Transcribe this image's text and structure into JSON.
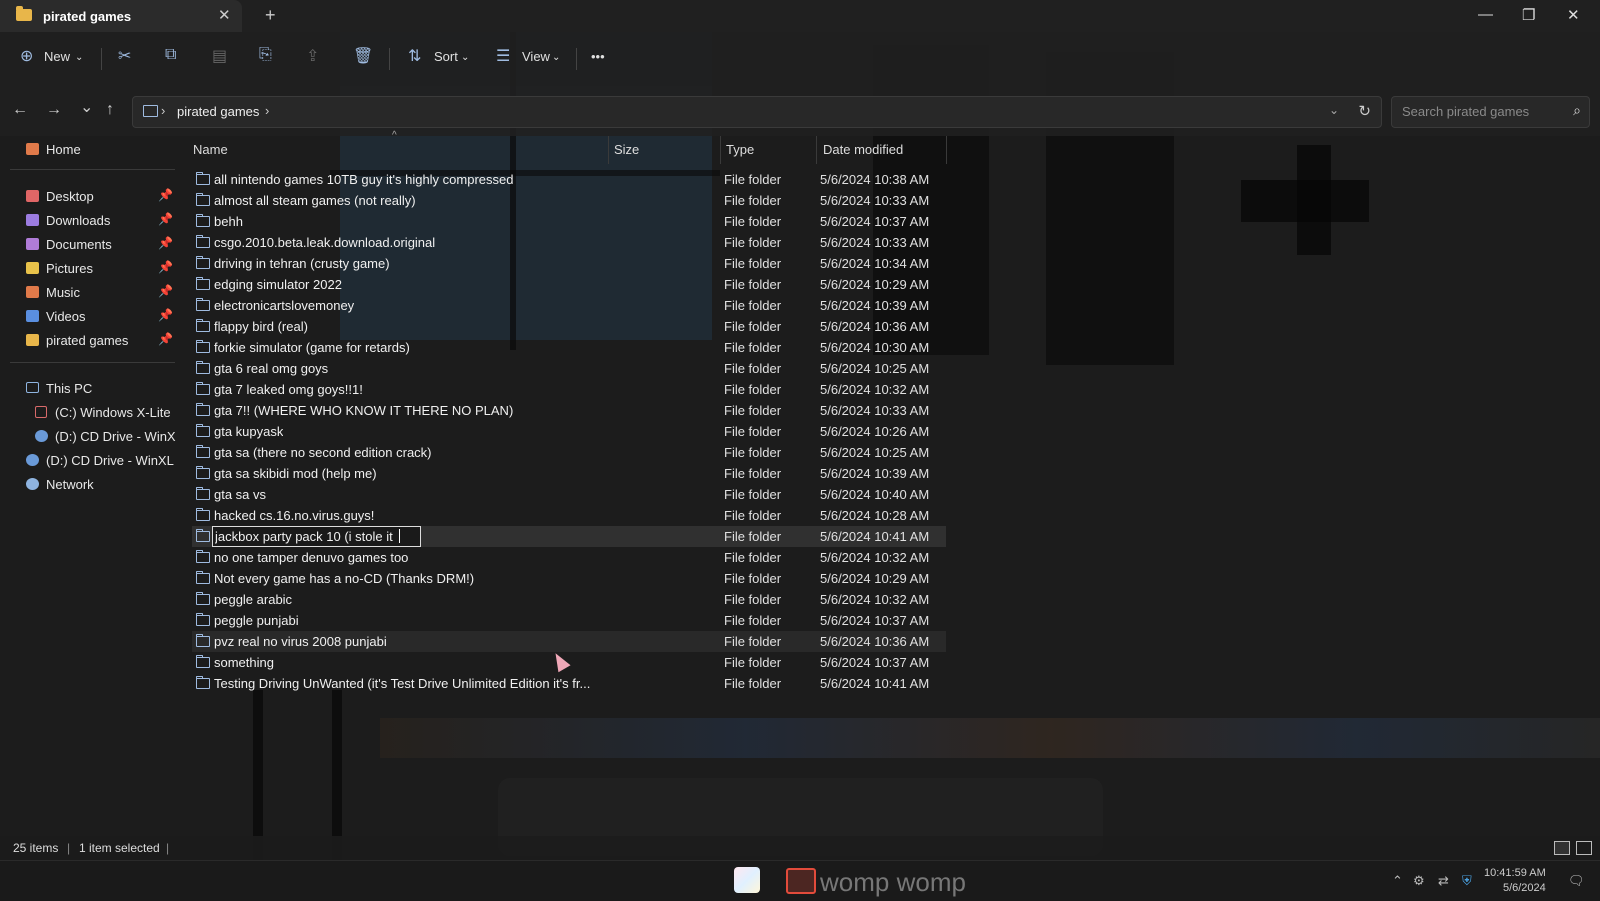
{
  "window": {
    "tab_title": "pirated games",
    "close_tab": "✕",
    "new_tab": "+",
    "minimize": "—",
    "maximize": "❐",
    "close": "✕"
  },
  "toolbar": {
    "new_label": "New",
    "sort_label": "Sort",
    "view_label": "View",
    "more": "•••"
  },
  "navigation": {
    "back": "←",
    "forward": "→",
    "recent": "⌄",
    "up": "↑",
    "breadcrumb": "pirated games",
    "search_placeholder": "Search pirated games"
  },
  "sidebar": {
    "home": "Home",
    "quick_access": [
      {
        "label": "Desktop",
        "color": "#e06666"
      },
      {
        "label": "Downloads",
        "color": "#9c7ce0"
      },
      {
        "label": "Documents",
        "color": "#b07cd8"
      },
      {
        "label": "Pictures",
        "color": "#e8c24a"
      },
      {
        "label": "Music",
        "color": "#e07a4a"
      },
      {
        "label": "Videos",
        "color": "#5a8fe0"
      },
      {
        "label": "pirated games",
        "color": "#e8b64a"
      }
    ],
    "this_pc": "This PC",
    "drives": [
      "(C:) Windows X-Lite",
      "(D:) CD Drive - WinX",
      "(D:) CD Drive - WinXL"
    ],
    "network": "Network"
  },
  "columns": {
    "name": "Name",
    "size": "Size",
    "type": "Type",
    "date": "Date modified"
  },
  "files": [
    {
      "name": "all nintendo games 10TB guy it's highly compressed",
      "type": "File folder",
      "date": "5/6/2024 10:38 AM"
    },
    {
      "name": "almost all steam games (not really)",
      "type": "File folder",
      "date": "5/6/2024 10:33 AM"
    },
    {
      "name": "behh",
      "type": "File folder",
      "date": "5/6/2024 10:37 AM"
    },
    {
      "name": "csgo.2010.beta.leak.download.original",
      "type": "File folder",
      "date": "5/6/2024 10:33 AM"
    },
    {
      "name": "driving in tehran (crusty game)",
      "type": "File folder",
      "date": "5/6/2024 10:34 AM"
    },
    {
      "name": "edging simulator 2022",
      "type": "File folder",
      "date": "5/6/2024 10:29 AM"
    },
    {
      "name": "electronicartslovemoney",
      "type": "File folder",
      "date": "5/6/2024 10:39 AM"
    },
    {
      "name": "flappy bird (real)",
      "type": "File folder",
      "date": "5/6/2024 10:36 AM"
    },
    {
      "name": "forkie simulator (game for retards)",
      "type": "File folder",
      "date": "5/6/2024 10:30 AM"
    },
    {
      "name": "gta 6 real omg goys",
      "type": "File folder",
      "date": "5/6/2024 10:25 AM"
    },
    {
      "name": "gta 7 leaked omg goys!!1!",
      "type": "File folder",
      "date": "5/6/2024 10:32 AM"
    },
    {
      "name": "gta 7!! (WHERE WHO KNOW IT THERE NO PLAN)",
      "type": "File folder",
      "date": "5/6/2024 10:33 AM"
    },
    {
      "name": "gta kupyask",
      "type": "File folder",
      "date": "5/6/2024 10:26 AM"
    },
    {
      "name": "gta sa (there no second edition crack)",
      "type": "File folder",
      "date": "5/6/2024 10:25 AM"
    },
    {
      "name": "gta sa skibidi mod (help me)",
      "type": "File folder",
      "date": "5/6/2024 10:39 AM"
    },
    {
      "name": "gta sa vs",
      "type": "File folder",
      "date": "5/6/2024 10:40 AM"
    },
    {
      "name": "hacked cs.16.no.virus.guys!",
      "type": "File folder",
      "date": "5/6/2024 10:28 AM"
    },
    {
      "name": "jackbox party pack 10 (i stole it",
      "type": "File folder",
      "date": "5/6/2024 10:41 AM",
      "state": "renaming"
    },
    {
      "name": "no one tamper denuvo games too",
      "type": "File folder",
      "date": "5/6/2024 10:32 AM"
    },
    {
      "name": "Not every game has a no-CD (Thanks DRM!)",
      "type": "File folder",
      "date": "5/6/2024 10:29 AM"
    },
    {
      "name": "peggle arabic",
      "type": "File folder",
      "date": "5/6/2024 10:32 AM"
    },
    {
      "name": "peggle punjabi",
      "type": "File folder",
      "date": "5/6/2024 10:37 AM"
    },
    {
      "name": "pvz real no virus 2008 punjabi",
      "type": "File folder",
      "date": "5/6/2024 10:36 AM",
      "state": "hover"
    },
    {
      "name": "something",
      "type": "File folder",
      "date": "5/6/2024 10:37 AM"
    },
    {
      "name": "Testing Driving UnWanted (it's Test Drive Unlimited Edition it's fr...",
      "type": "File folder",
      "date": "5/6/2024 10:41 AM"
    }
  ],
  "status": {
    "item_count": "25 items",
    "selection": "1 item selected"
  },
  "taskbar": {
    "label": "womp womp",
    "time": "10:41:59 AM",
    "date": "5/6/2024"
  }
}
